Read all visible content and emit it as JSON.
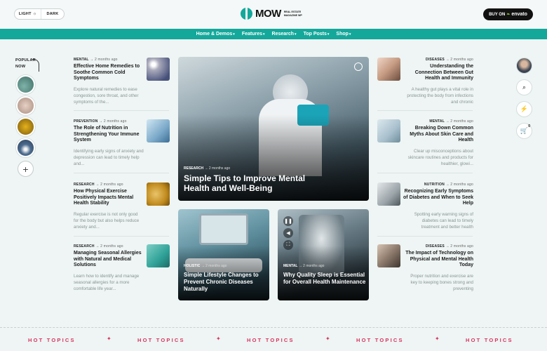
{
  "theme_toggle": {
    "light": "LIGHT",
    "dark": "DARK"
  },
  "logo": {
    "name": "MOW",
    "tagline": "REAL ESTATE MAGAZINE WP"
  },
  "buy_button": {
    "prefix": "BUY ON",
    "brand": "envato"
  },
  "nav": [
    {
      "label": "Home & Demos"
    },
    {
      "label": "Features"
    },
    {
      "label": "Research"
    },
    {
      "label": "Top Posts"
    },
    {
      "label": "Shop"
    }
  ],
  "popular": {
    "label_line1": "POPULAR",
    "label_line2": "NOW"
  },
  "left_articles": [
    {
      "category": "MENTAL",
      "time": "2 months ago",
      "title": "Effective Home Remedies to Soothe Common Cold Symptoms",
      "excerpt": "Explore natural remedies to ease congestion, sore throat, and other symptoms of the..."
    },
    {
      "category": "PREVENTION",
      "time": "2 months ago",
      "title": "The Role of Nutrition in Strengthening Your Immune System",
      "excerpt": "Identifying early signs of anxiety and depression can lead to timely help and..."
    },
    {
      "category": "RESEARCH",
      "time": "2 months ago",
      "title": "How Physical Exercise Positively Impacts Mental Health Stability",
      "excerpt": "Regular exercise is not only good for the body but also helps reduce anxiety and..."
    },
    {
      "category": "RESEARCH",
      "time": "2 months ago",
      "title": "Managing Seasonal Allergies with Natural and Medical Solutions",
      "excerpt": "Learn how to identify and manage seasonal allergies for a more comfortable life year..."
    }
  ],
  "right_articles": [
    {
      "category": "DISEASES",
      "time": "2 months ago",
      "title": "Understanding the Connection Between Gut Health and Immunity",
      "excerpt": "A healthy gut plays a vital role in protecting the body from infections and chronic"
    },
    {
      "category": "MENTAL",
      "time": "2 months ago",
      "title": "Breaking Down Common Myths About Skin Care and Health",
      "excerpt": "Clear up misconceptions about skincare routines and products for healthier, glowi..."
    },
    {
      "category": "NUTRITION",
      "time": "2 months ago",
      "title": "Recognizing Early Symptoms of Diabetes and When to Seek Help",
      "excerpt": "Spotting early warning signs of diabetes can lead to timely treatment and better health"
    },
    {
      "category": "DISEASES",
      "time": "2 months ago",
      "title": "The Impact of Technology on Physical and Mental Health Today",
      "excerpt": "Proper nutrition and exercise are key to keeping bones strong and preventing"
    }
  ],
  "feature": {
    "category": "RESEARCH",
    "time": "2 months ago",
    "title": "Simple Tips to Improve Mental Health and Well-Being"
  },
  "card_a": {
    "category": "HOLISTIC",
    "time": "2 months ago",
    "title": "Simple Lifestyle Changes to Prevent Chronic Diseases Naturally"
  },
  "card_b": {
    "category": "MENTAL",
    "time": "2 months ago",
    "title": "Why Quality Sleep is Essential for Overall Health Maintenance"
  },
  "cart": {
    "count": "0"
  },
  "hot_topics": [
    "HOT TOPICS",
    "HOT TOPICS",
    "HOT TOPICS",
    "HOT TOPICS",
    "HOT TOPICS"
  ],
  "colors": {
    "accent": "#14a89b",
    "hot": "#d8345f"
  }
}
